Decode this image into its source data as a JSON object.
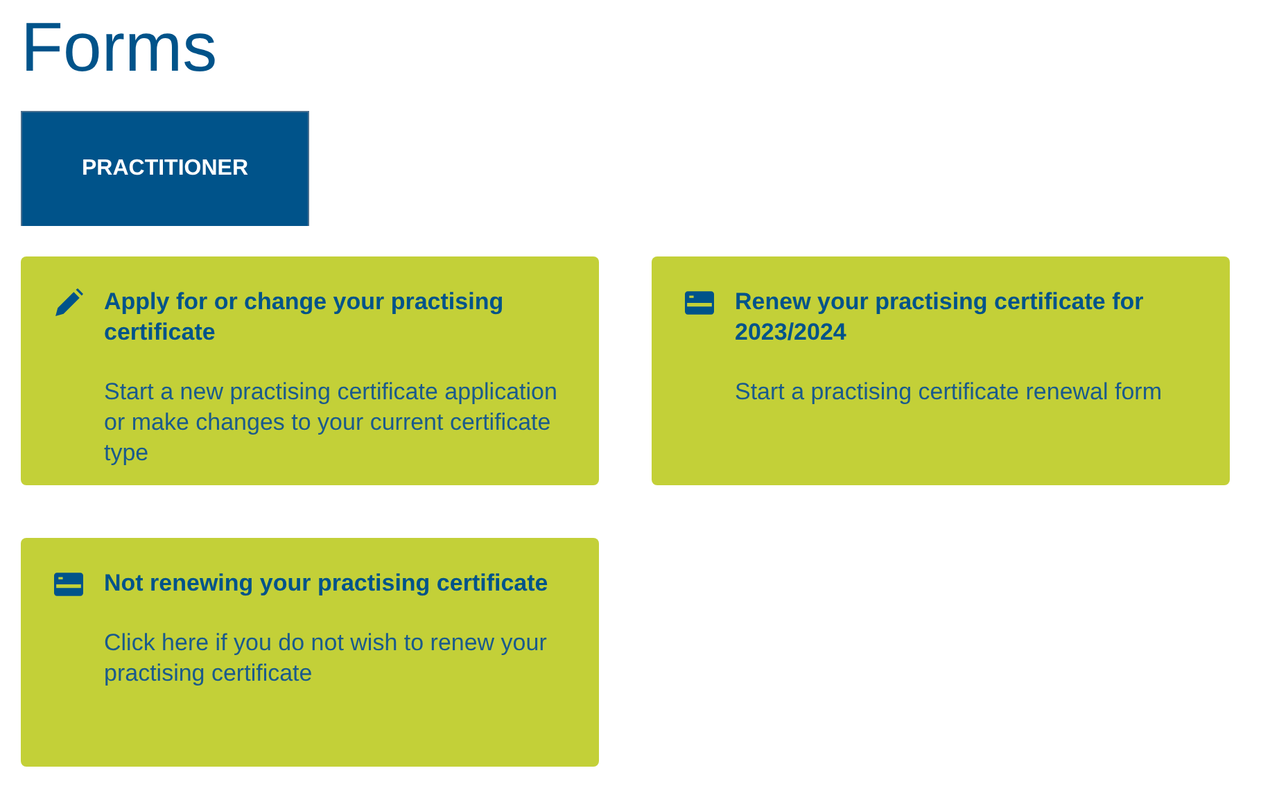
{
  "page_title": "Forms",
  "tabs": [
    {
      "label": "PRACTITIONER",
      "selected": true
    }
  ],
  "cards": [
    {
      "kind": "pencil",
      "title": "Apply for or change your practising certificate",
      "description": "Start a new practising certificate application or make changes to your current certificate type"
    },
    {
      "kind": "card",
      "title": "Renew your practising certificate for 2023/2024",
      "description": "Start a practising certificate renewal form"
    },
    {
      "kind": "card",
      "title": "Not renewing your practising certificate",
      "description": "Click here if you do not wish to renew your practising certificate"
    }
  ]
}
